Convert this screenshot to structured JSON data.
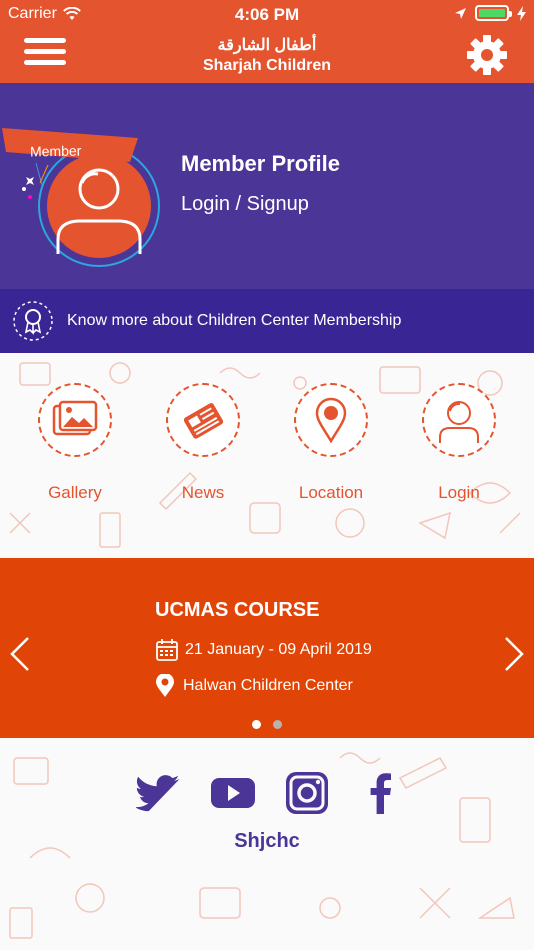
{
  "status_bar": {
    "carrier": "Carrier",
    "time": "4:06 PM"
  },
  "header": {
    "title_ar": "أطفال الشارقة",
    "title_en": "Sharjah Children"
  },
  "profile": {
    "badge": "Member",
    "title": "Member Profile",
    "login_link": "Login / Signup"
  },
  "membership": {
    "text": "Know more about Children Center Membership"
  },
  "quick_links": [
    {
      "label": "Gallery",
      "icon": "gallery-icon"
    },
    {
      "label": "News",
      "icon": "news-icon"
    },
    {
      "label": "Location",
      "icon": "location-pin-icon"
    },
    {
      "label": "Login",
      "icon": "user-icon"
    }
  ],
  "event": {
    "title": "UCMAS COURSE",
    "date": "21 January - 09 April 2019",
    "location": "Halwan Children Center",
    "page_count": 2,
    "active_page": 1
  },
  "social": {
    "icons": [
      "twitter-icon",
      "youtube-icon",
      "instagram-icon",
      "facebook-icon"
    ],
    "handle": "Shjchc"
  },
  "colors": {
    "orange": "#e4542f",
    "event_orange": "#e04507",
    "purple": "#4b3596",
    "dark_purple": "#3a2594"
  }
}
